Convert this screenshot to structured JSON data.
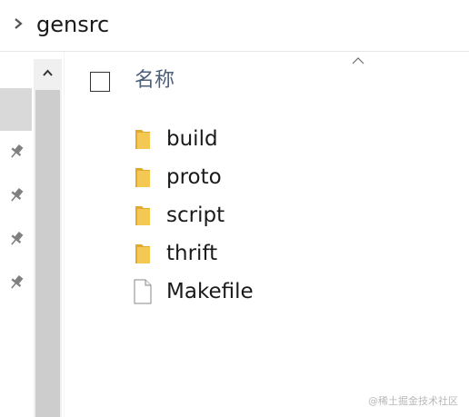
{
  "breadcrumb": {
    "chevron_icon": "chevron-right-icon",
    "current_folder": "gensrc"
  },
  "nav_pane": {
    "pin_icon": "pin-icon",
    "scroll_up_icon": "chevron-up-icon"
  },
  "header": {
    "name_column": "名称",
    "sort_indicator_icon": "sort-ascending-icon"
  },
  "files": [
    {
      "name": "build",
      "type": "folder",
      "icon": "folder-icon"
    },
    {
      "name": "proto",
      "type": "folder",
      "icon": "folder-icon"
    },
    {
      "name": "script",
      "type": "folder",
      "icon": "folder-icon"
    },
    {
      "name": "thrift",
      "type": "folder",
      "icon": "folder-icon"
    },
    {
      "name": "Makefile",
      "type": "file",
      "icon": "file-icon"
    }
  ],
  "watermark": "@稀土掘金技术社区",
  "colors": {
    "folder": "#f3c853",
    "header_text": "#4c607a",
    "selection": "#d9d9d9",
    "scrollbar_thumb": "#cdcdcd"
  }
}
